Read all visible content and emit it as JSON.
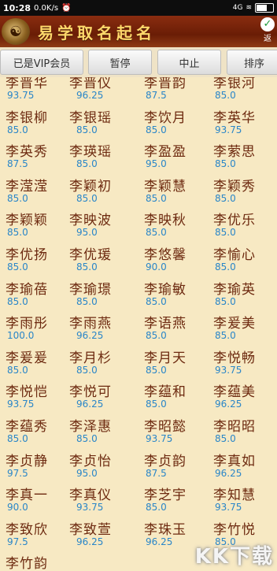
{
  "status_bar": {
    "time": "10:28",
    "net_speed": "0.0K/s",
    "signal": "4G",
    "battery_level": 0.7
  },
  "header": {
    "logo_icon": "dragon-logo-icon",
    "title": "易学取名起名",
    "back_label": "返"
  },
  "toolbar": {
    "vip_label": "已是VIP会员",
    "pause_label": "暂停",
    "stop_label": "中止",
    "sort_label": "排序"
  },
  "names": [
    {
      "name": "李晋华",
      "score": "93.75"
    },
    {
      "name": "李晋仪",
      "score": "96.25"
    },
    {
      "name": "李晋韵",
      "score": "87.5"
    },
    {
      "name": "李银河",
      "score": "85.0"
    },
    {
      "name": "李银柳",
      "score": "85.0"
    },
    {
      "name": "李银瑶",
      "score": "85.0"
    },
    {
      "name": "李饮月",
      "score": "85.0"
    },
    {
      "name": "李英华",
      "score": "93.75"
    },
    {
      "name": "李英秀",
      "score": "87.5"
    },
    {
      "name": "李瑛瑶",
      "score": "85.0"
    },
    {
      "name": "李盈盈",
      "score": "95.0"
    },
    {
      "name": "李萦思",
      "score": "85.0"
    },
    {
      "name": "李滢滢",
      "score": "85.0"
    },
    {
      "name": "李颖初",
      "score": "85.0"
    },
    {
      "name": "李颖慧",
      "score": "85.0"
    },
    {
      "name": "李颖秀",
      "score": "85.0"
    },
    {
      "name": "李颖颖",
      "score": "85.0"
    },
    {
      "name": "李映波",
      "score": "95.0"
    },
    {
      "name": "李映秋",
      "score": "85.0"
    },
    {
      "name": "李优乐",
      "score": "85.0"
    },
    {
      "name": "李优扬",
      "score": "85.0"
    },
    {
      "name": "李优瑗",
      "score": "85.0"
    },
    {
      "name": "李悠馨",
      "score": "90.0"
    },
    {
      "name": "李愉心",
      "score": "85.0"
    },
    {
      "name": "李瑜蓓",
      "score": "85.0"
    },
    {
      "name": "李瑜璟",
      "score": "85.0"
    },
    {
      "name": "李瑜敏",
      "score": "85.0"
    },
    {
      "name": "李瑜英",
      "score": "85.0"
    },
    {
      "name": "李雨彤",
      "score": "100.0"
    },
    {
      "name": "李雨燕",
      "score": "96.25"
    },
    {
      "name": "李语燕",
      "score": "85.0"
    },
    {
      "name": "李爰美",
      "score": "85.0"
    },
    {
      "name": "李爰爰",
      "score": "85.0"
    },
    {
      "name": "李月杉",
      "score": "85.0"
    },
    {
      "name": "李月天",
      "score": "85.0"
    },
    {
      "name": "李悦畅",
      "score": "93.75"
    },
    {
      "name": "李悦恺",
      "score": "93.75"
    },
    {
      "name": "李悦可",
      "score": "96.25"
    },
    {
      "name": "李蕴和",
      "score": "85.0"
    },
    {
      "name": "李蕴美",
      "score": "96.25"
    },
    {
      "name": "李蕴秀",
      "score": "85.0"
    },
    {
      "name": "李泽惠",
      "score": "85.0"
    },
    {
      "name": "李昭懿",
      "score": "93.75"
    },
    {
      "name": "李昭昭",
      "score": "85.0"
    },
    {
      "name": "李贞静",
      "score": "97.5"
    },
    {
      "name": "李贞怡",
      "score": "95.0"
    },
    {
      "name": "李贞韵",
      "score": "87.5"
    },
    {
      "name": "李真如",
      "score": "96.25"
    },
    {
      "name": "李真一",
      "score": "90.0"
    },
    {
      "name": "李真仪",
      "score": "93.75"
    },
    {
      "name": "李芝宇",
      "score": "85.0"
    },
    {
      "name": "李知慧",
      "score": "93.75"
    },
    {
      "name": "李致欣",
      "score": "97.5"
    },
    {
      "name": "李致萱",
      "score": "96.25"
    },
    {
      "name": "李珠玉",
      "score": "96.25"
    },
    {
      "name": "李竹悦",
      "score": "85.0"
    },
    {
      "name": "李竹韵",
      "score": ""
    }
  ],
  "watermark": "KK下载"
}
